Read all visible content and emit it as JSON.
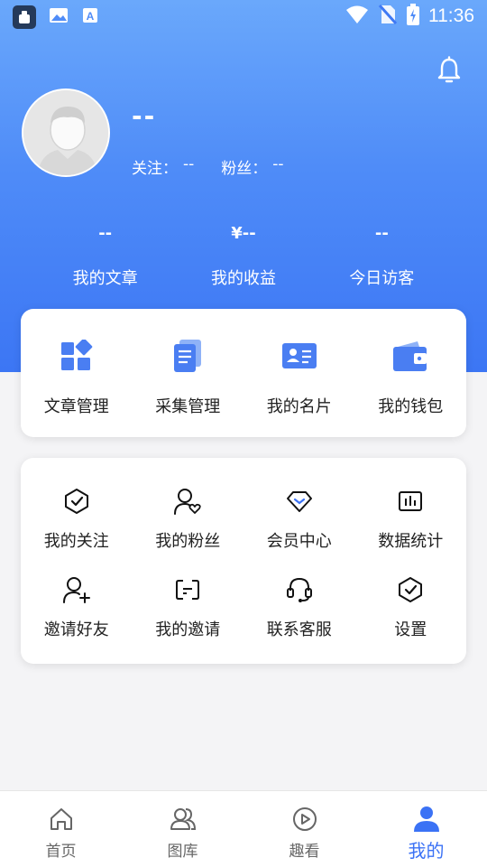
{
  "status_bar": {
    "time": "11:36",
    "icons": [
      "app-icon",
      "image-icon",
      "a-icon",
      "wifi-icon",
      "no-sim-icon",
      "battery-charging-icon"
    ]
  },
  "colors": {
    "primary": "#3b72f5",
    "gradient_top": "#6aa8fb",
    "gradient_bottom": "#3c76f4"
  },
  "header": {
    "bell_icon": "bell-icon",
    "nickname": "--",
    "follow_label": "关注：",
    "follow_value": "--",
    "fans_label": "粉丝：",
    "fans_value": "--"
  },
  "stats": [
    {
      "value": "--",
      "label": "我的文章"
    },
    {
      "value": "¥--",
      "label": "我的收益"
    },
    {
      "value": "--",
      "label": "今日访客"
    }
  ],
  "main_tools": [
    {
      "label": "文章管理",
      "icon": "grid-icon"
    },
    {
      "label": "采集管理",
      "icon": "documents-icon"
    },
    {
      "label": "我的名片",
      "icon": "card-icon"
    },
    {
      "label": "我的钱包",
      "icon": "wallet-icon"
    }
  ],
  "more_tools": [
    {
      "label": "我的关注",
      "icon": "shield-check-icon"
    },
    {
      "label": "我的粉丝",
      "icon": "user-heart-icon"
    },
    {
      "label": "会员中心",
      "icon": "diamond-icon"
    },
    {
      "label": "数据统计",
      "icon": "bar-chart-icon"
    },
    {
      "label": "邀请好友",
      "icon": "user-plus-icon"
    },
    {
      "label": "我的邀请",
      "icon": "invite-icon"
    },
    {
      "label": "联系客服",
      "icon": "headset-icon"
    },
    {
      "label": "设置",
      "icon": "settings-icon"
    }
  ],
  "bottom_nav": [
    {
      "label": "首页",
      "icon": "home-icon",
      "active": false
    },
    {
      "label": "图库",
      "icon": "gallery-icon",
      "active": false
    },
    {
      "label": "趣看",
      "icon": "play-icon",
      "active": false
    },
    {
      "label": "我的",
      "icon": "profile-icon",
      "active": true
    }
  ]
}
